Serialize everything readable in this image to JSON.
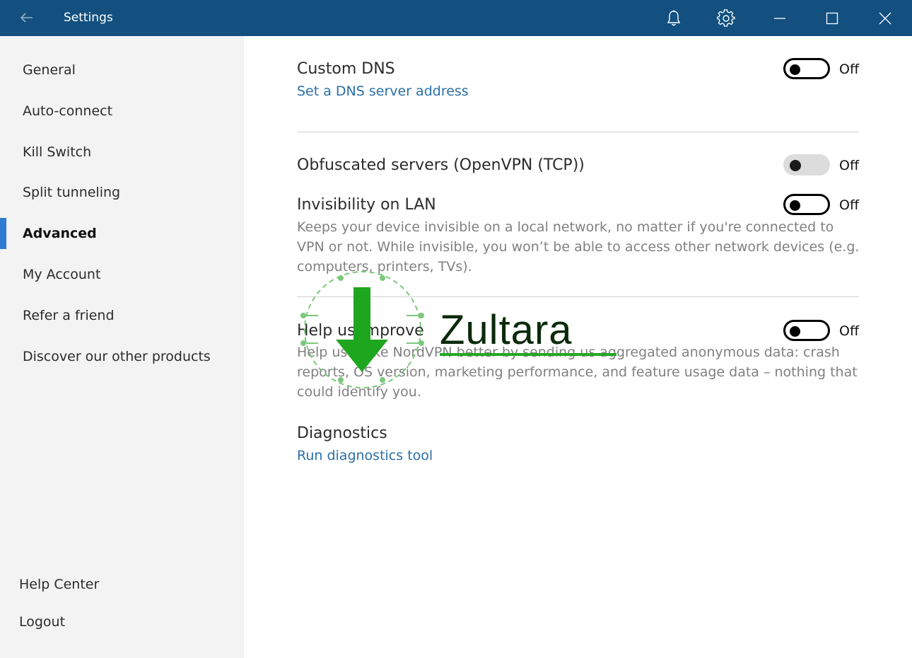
{
  "window": {
    "title": "Settings",
    "icons": {
      "back": "back-arrow-icon",
      "notifications": "bell-icon",
      "settings": "gear-icon",
      "minimize": "minimize-icon",
      "maximize": "maximize-icon",
      "close": "close-icon"
    }
  },
  "sidebar": {
    "items": [
      {
        "label": "General"
      },
      {
        "label": "Auto-connect"
      },
      {
        "label": "Kill Switch"
      },
      {
        "label": "Split tunneling"
      },
      {
        "label": "Advanced",
        "active": true
      },
      {
        "label": "My Account"
      },
      {
        "label": "Refer a friend"
      },
      {
        "label": "Discover our other products"
      }
    ],
    "bottom_items": [
      {
        "label": "Help Center"
      },
      {
        "label": "Logout"
      }
    ],
    "accent_color": "#2d7cd1"
  },
  "main": {
    "custom_dns": {
      "title": "Custom DNS",
      "link": "Set a DNS server address",
      "state": "Off"
    },
    "obfuscated": {
      "title": "Obfuscated servers (OpenVPN (TCP))",
      "state": "Off",
      "disabled": true
    },
    "invisibility": {
      "title": "Invisibility on LAN",
      "description": "Keeps your device invisible on a local network, no matter if you're connected to VPN or not. While invisible, you won’t be able to access other network devices (e.g. computers, printers, TVs).",
      "state": "Off"
    },
    "help_improve": {
      "title": "Help us improve",
      "description": "Help us make NordVPN better by sending us aggregated anonymous data: crash reports, OS version, marketing performance, and feature usage data – nothing that could identify you.",
      "state": "Off"
    },
    "diagnostics": {
      "title": "Diagnostics",
      "link": "Run diagnostics tool"
    }
  },
  "watermark": {
    "text": "Zultara",
    "color": "#22aa22"
  },
  "colors": {
    "titlebar": "#13507f",
    "link": "#2a6fa8",
    "sidebar_bg": "#f3f3f3"
  }
}
